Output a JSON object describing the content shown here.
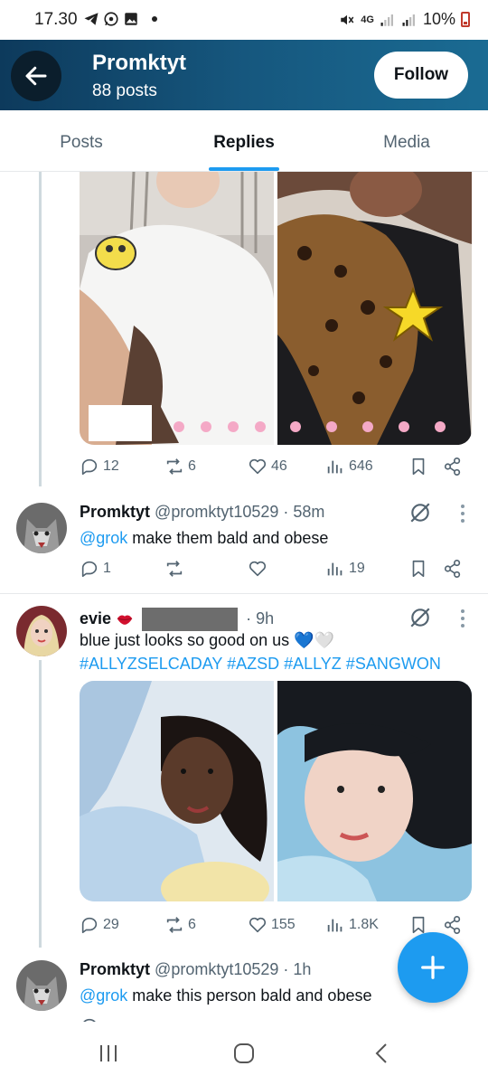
{
  "status_bar": {
    "time": "17.30",
    "network": "4G",
    "battery": "10%"
  },
  "header": {
    "name": "Promktyt",
    "posts_count": "88 posts",
    "follow_label": "Follow"
  },
  "tabs": [
    {
      "label": "Posts",
      "active": false
    },
    {
      "label": "Replies",
      "active": true
    },
    {
      "label": "Media",
      "active": false
    }
  ],
  "posts": [
    {
      "stats": {
        "replies": "12",
        "reposts": "6",
        "likes": "46",
        "views": "646"
      }
    },
    {
      "author": "Promktyt",
      "handle": "@promktyt10529 · 58m",
      "mention": "@grok",
      "text": " make them bald and obese",
      "stats": {
        "replies": "1",
        "reposts": "",
        "likes": "",
        "views": "19"
      }
    },
    {
      "author": "evie",
      "handle": "· 9h",
      "text": "blue just looks so good on us 💙🤍",
      "hashtags": "#ALLYZSELCADAY #AZSD #ALLYZ #SANGWON",
      "stats": {
        "replies": "29",
        "reposts": "6",
        "likes": "155",
        "views": "1.8K"
      }
    },
    {
      "author": "Promktyt",
      "handle": "@promktyt10529 · 1h",
      "mention": "@grok",
      "text": " make this person bald and obese"
    }
  ],
  "colors": {
    "accent": "#1d9bf0",
    "header_dark": "#0d3a5c",
    "muted": "#536471"
  }
}
